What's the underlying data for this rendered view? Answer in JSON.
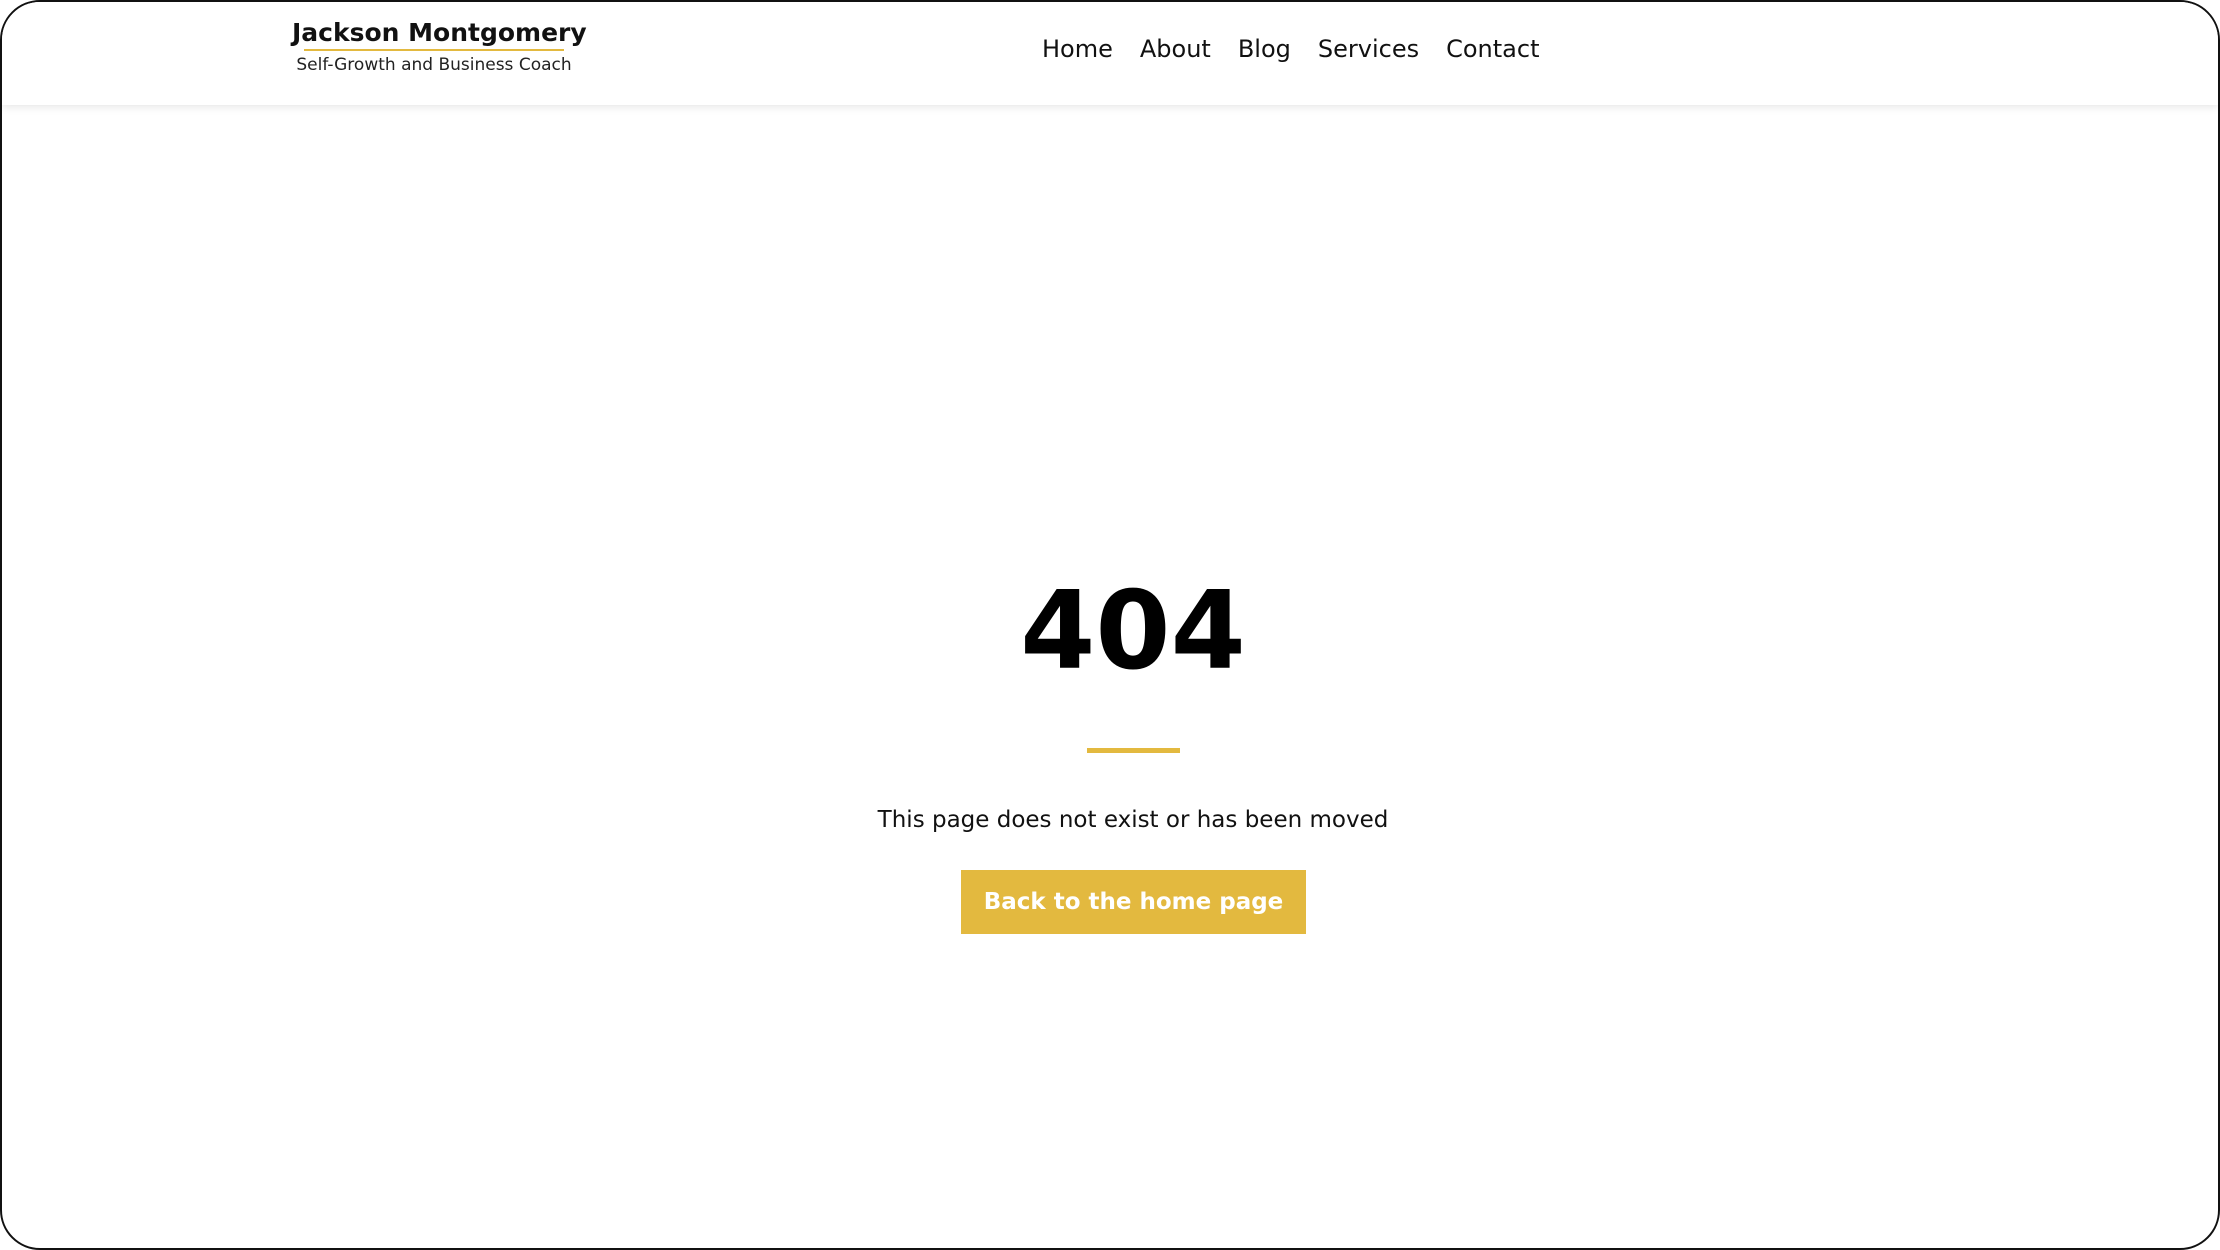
{
  "header": {
    "brand": {
      "name": "Jackson Montgomery",
      "tagline": "Self-Growth and Business Coach"
    },
    "nav": [
      {
        "label": "Home"
      },
      {
        "label": "About"
      },
      {
        "label": "Blog"
      },
      {
        "label": "Services"
      },
      {
        "label": "Contact"
      }
    ]
  },
  "main": {
    "error_code": "404",
    "message": "This page does not exist or has been moved",
    "button_label": "Back to the home page"
  },
  "colors": {
    "accent": "#e3b93f",
    "text": "#111111",
    "background": "#ffffff"
  }
}
